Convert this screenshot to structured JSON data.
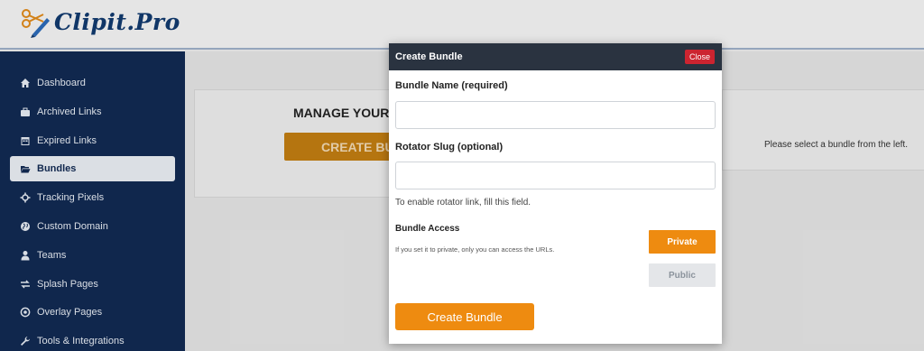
{
  "app": {
    "logo_text": "Clipit.Pro"
  },
  "sidebar": {
    "items": [
      {
        "label": "Dashboard",
        "icon": "home-icon"
      },
      {
        "label": "Archived Links",
        "icon": "briefcase-icon"
      },
      {
        "label": "Expired Links",
        "icon": "calendar-icon"
      },
      {
        "label": "Bundles",
        "icon": "folder-open-icon",
        "active": true
      },
      {
        "label": "Tracking Pixels",
        "icon": "crosshair-icon"
      },
      {
        "label": "Custom Domain",
        "icon": "globe-icon"
      },
      {
        "label": "Teams",
        "icon": "user-icon"
      },
      {
        "label": "Splash Pages",
        "icon": "exchange-icon"
      },
      {
        "label": "Overlay Pages",
        "icon": "target-icon"
      },
      {
        "label": "Tools & Integrations",
        "icon": "wrench-icon"
      }
    ]
  },
  "main": {
    "manage_title": "MANAGE YOUR",
    "create_button_partial": "CREATE BU",
    "select_hint": "Please select a bundle from the left."
  },
  "modal": {
    "title": "Create Bundle",
    "close_label": "Close",
    "bundle_name_label": "Bundle Name (required)",
    "bundle_name_value": "",
    "rotator_slug_label": "Rotator Slug (optional)",
    "rotator_slug_value": "",
    "rotator_hint": "To enable rotator link, fill this field.",
    "access_label": "Bundle Access",
    "access_note": "If you set it to private, only you can access the URLs.",
    "private_label": "Private",
    "public_label": "Public",
    "create_label": "Create Bundle"
  },
  "colors": {
    "sidebar_bg": "#122a52",
    "accent_orange": "#ee8b10",
    "close_red": "#cc2430",
    "modal_header": "#2a3340"
  }
}
